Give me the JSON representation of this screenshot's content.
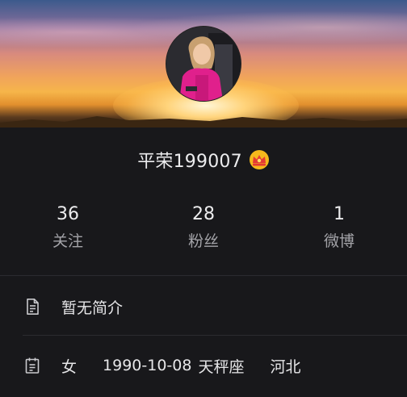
{
  "profile": {
    "name": "平荣199007",
    "crown_icon": "crown-icon",
    "stats": [
      {
        "value": "36",
        "label": "关注"
      },
      {
        "value": "28",
        "label": "粉丝"
      },
      {
        "value": "1",
        "label": "微博"
      }
    ],
    "bio": "暂无简介",
    "details": {
      "gender": "女",
      "birthday": "1990-10-08",
      "zodiac": "天秤座",
      "location": "河北"
    }
  },
  "colors": {
    "background": "#18181b",
    "text_primary": "#ececee",
    "text_secondary": "#a3a3a8",
    "divider": "#2b2b30",
    "crown_gold": "#f5b81c",
    "crown_red": "#e53935"
  }
}
